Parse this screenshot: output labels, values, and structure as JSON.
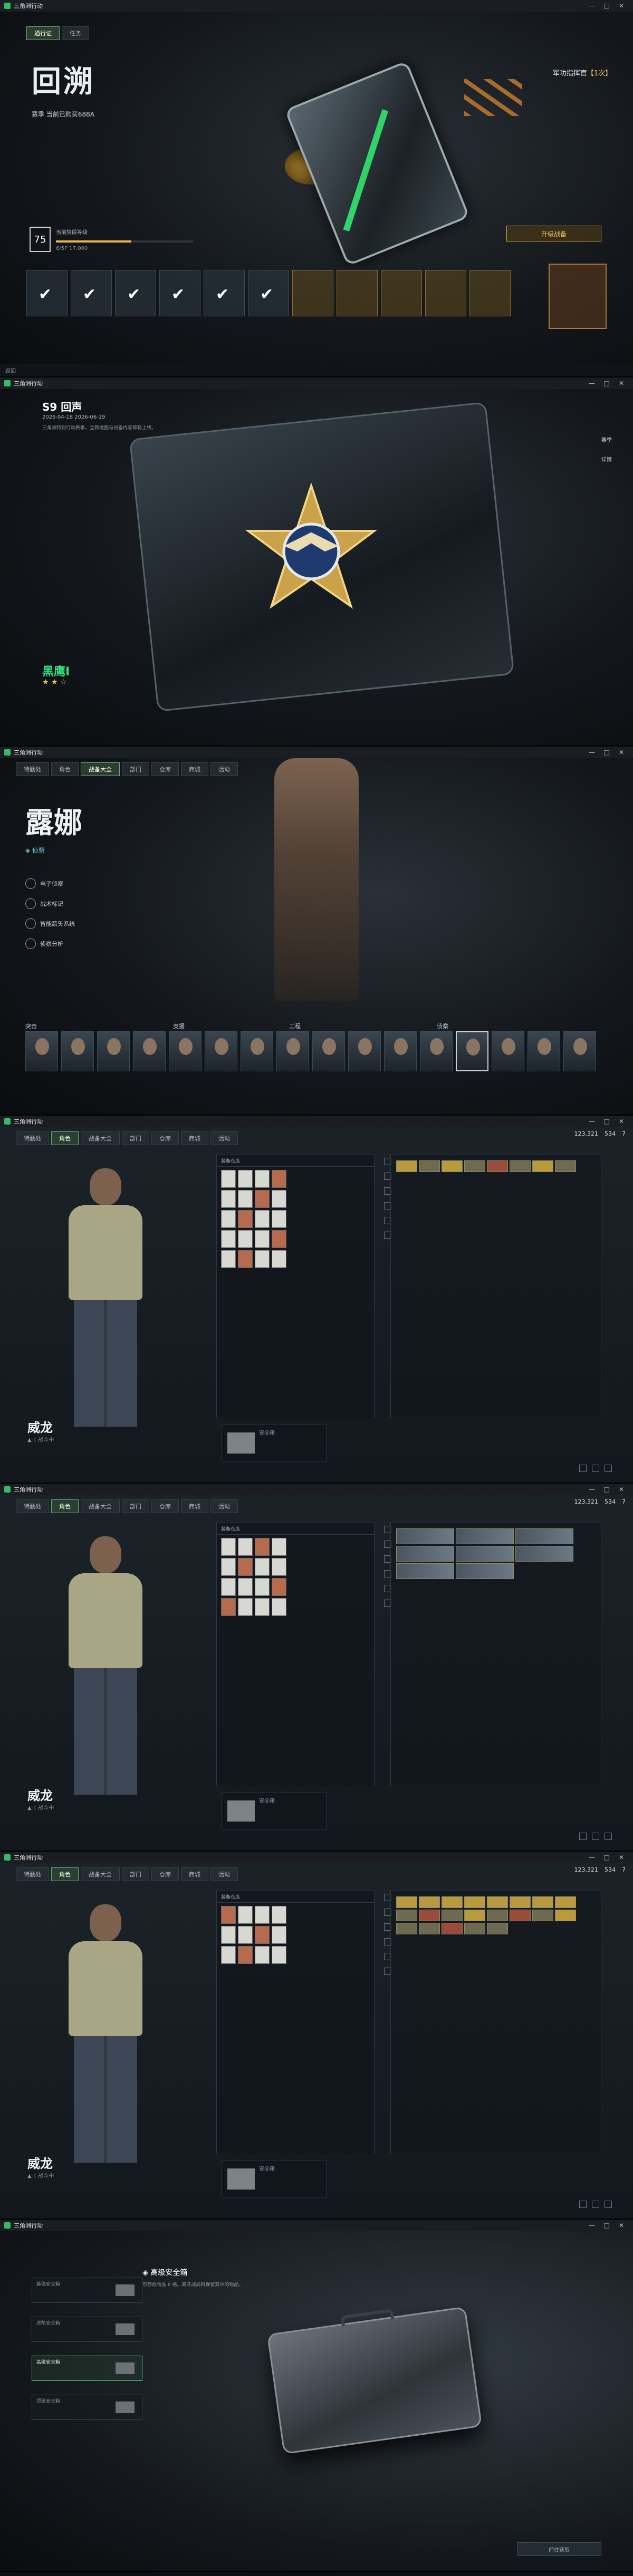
{
  "window": {
    "title": "三角洲行动",
    "minimize": "—",
    "maximize": "□",
    "close": "✕"
  },
  "topbar": {
    "tabs": [
      "特勤处",
      "角色",
      "战备大全",
      "部门",
      "仓库",
      "商城",
      "活动"
    ],
    "currency": [
      "123,321",
      "534",
      "7"
    ]
  },
  "battlepass": {
    "tabs": [
      "通行证",
      "任务"
    ],
    "title": "回溯",
    "subtitle": "赛季 当前已购买688A",
    "reward_name_prefix": "军功指挥官",
    "reward_name_suffix": "【1次】",
    "level": "75",
    "level_label": "当前阶段等级",
    "xp_text": "6/5P 17,000",
    "xp_fraction": 0.55,
    "buy_button": "升级战备",
    "footer": "返回"
  },
  "season": {
    "name": "S9 回声",
    "dates": "2026-04-18 2026-06-19",
    "desc": "三角洲特别行动赛季，全新地图与战备内容即将上线。",
    "rank": "黑鹰I",
    "stars": "★ ★ ☆",
    "side_buttons": [
      "赛季",
      "详情"
    ]
  },
  "operator": {
    "name": "露娜",
    "role": "◈ 侦察",
    "skills": [
      "电子侦察",
      "战术标记",
      "智能箭矢系统",
      "侦察分析"
    ],
    "groups": [
      "突击",
      "支援",
      "工程",
      "侦察"
    ]
  },
  "inventory": {
    "name": "威龙",
    "sub": "▲ 1 战斗中",
    "mid_header": "装备仓库",
    "sec_label": "安全箱"
  },
  "safebox": {
    "items": [
      "基础安全箱",
      "进阶安全箱",
      "高级安全箱",
      "顶级安全箱"
    ],
    "title": "◈ 高级安全箱",
    "desc": "可存放物品 6 格。离开战局时保留其中的物品。",
    "button": "前往获取"
  }
}
